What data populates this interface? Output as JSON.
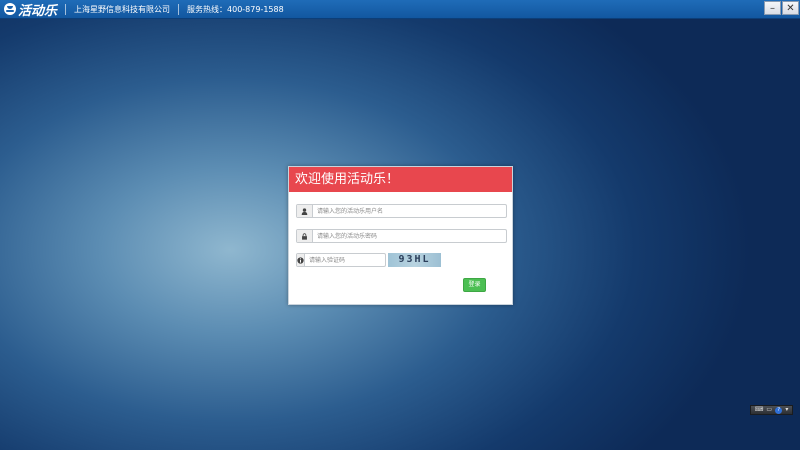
{
  "titlebar": {
    "app_name": "活动乐",
    "company": "上海星野信息科技有限公司",
    "hotline": "服务热线：400-879-1588",
    "minimize_label": "–",
    "close_label": "✕"
  },
  "login": {
    "title": "欢迎使用活动乐！",
    "username_placeholder": "请输入您的活动乐用户名",
    "password_placeholder": "请输入您的活动乐密码",
    "captcha_placeholder": "请输入验证码",
    "captcha_text": "93HL",
    "submit_label": "登录",
    "icons": {
      "username": "user-icon",
      "password": "lock-icon",
      "captcha": "info-icon"
    }
  },
  "tray": {
    "help_label": "?"
  },
  "colors": {
    "titlebar": "#1a62ad",
    "dialog_header": "#e8474e",
    "login_button": "#4cbf53"
  }
}
